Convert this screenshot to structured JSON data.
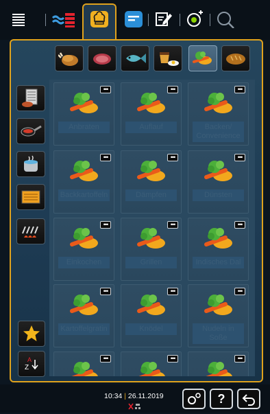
{
  "topbar": {
    "icons": [
      "menu-icon",
      "cooking-cabinet-icon",
      "chef-hat-icon",
      "program-list-icon",
      "edit-note-icon",
      "smart-timer-icon",
      "search-icon"
    ],
    "active": "chef-hat-icon",
    "accent": "#e0a21c"
  },
  "categories": [
    {
      "name": "poultry",
      "icon": "chicken-icon"
    },
    {
      "name": "meat",
      "icon": "steak-icon"
    },
    {
      "name": "fish",
      "icon": "fish-icon"
    },
    {
      "name": "egg-dishes",
      "icon": "pudding-egg-icon"
    },
    {
      "name": "side-dishes",
      "icon": "vegetables-icon",
      "selected": true
    },
    {
      "name": "bakery",
      "icon": "bread-icon"
    }
  ],
  "side_categories": [
    "stack-plates-icon",
    "pan-icon",
    "pot-icon",
    "oven-icon",
    "grill-icon"
  ],
  "tiles": [
    "Anbraten",
    "Auflauf",
    "Backen/\nConvenience",
    "Backkartoffeln",
    "Dämpfen",
    "Dünsten",
    "Einkochen",
    "Grillen",
    "Indisches Dal",
    "Kartoffelgratin",
    "Knödel",
    "Nudeln in\nSoße",
    "",
    "",
    ""
  ],
  "tile_menu_glyph": "•••",
  "bottom": {
    "time": "10:34",
    "separator": "|",
    "date": "26.11.2019",
    "settings_icon": "settings-icon",
    "help_label": "?",
    "back_icon": "back-icon"
  },
  "sort_label": "A Z"
}
